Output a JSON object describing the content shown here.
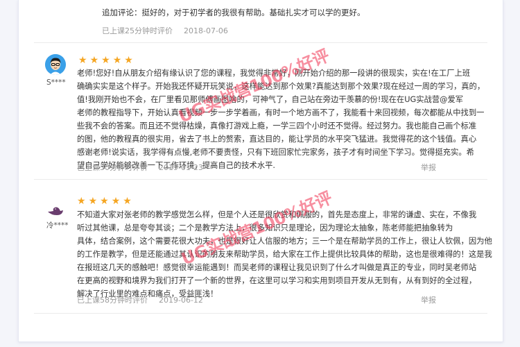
{
  "previous_review": {
    "followup_text": "追加评论：挺好的，对于初学者的我很有帮助。基础扎实才可以学的更好。",
    "meta_time": "已上课25分钟时评价",
    "date": "2018-07-06"
  },
  "reviews": [
    {
      "username": "S****",
      "stars": 5,
      "lines": [
        "老师!您好!自从朋友介绍有缘认识了您的课程，我觉得非常好，刚开始介绍的那一段讲的很现实，实在!在工厂上班",
        "确确实实是这个样子。开始我还怀疑开玩笑说，这样能达到那个效果?真能达到那个效果?现在经过一周的学习，真的，",
        "值!我刚开始也不会，在厂里看见那师傅画图啥的，可神气了，自己站在旁边干羡慕的份!现在在UG实战营@爱军",
        "老师的教程指导下，开始认真看视频一步一步学着画，有时一个地方画不了，我能看十来回视频，每次都能从中找到一",
        "些我不会的答案。而且还不觉得枯燥，真像打游戏上瘾，一学三四个小时还不觉得。经过努力。我也能自己画个标准",
        "的图，他的教程真的很实用，省去了书上的赘索，直达目的，能让学员的水平突飞猛进。我觉得花的这个钱值。真心",
        "感谢老师!说实话，我学得有点慢,老师不要责怪，只有下班回家忙完家务，孩子才有时间坐下学习。觉得挺充实。希",
        "望自己学好能够改善一下工作环境，提高自己的技术水平."
      ],
      "meta_time": "已上课30分钟时评价",
      "date": "2019-01-23",
      "report": "举报"
    },
    {
      "username": "冷****",
      "stars": 5,
      "lines": [
        "不知道大家对张老师的教学感觉怎么样，但是个人还是很欣赏和佩服的，首先是态度上，非常的谦虚、实在，不像我",
        "听过其他课，总是夸夸其谈；二个是教学方法上，很多知识只是理论，因为理论太抽象，陈老师能把抽象转为",
        "具体，结合案例，这个需要花很大功夫，也是很好让人信服的地方；三一个是在帮助学员的工作上，很让人钦佩，因为他",
        "的工作是教学，但是还能通过其认识的朋友来帮助学员，给大家在工作上提供比较具体的帮助，这也是很难得的！这是我",
        "在报班这几天的感触吧！感觉很幸运能遇到！而吴老师的课程让我见识到了什么才叫做是真正的专业，同时吴老师站",
        "在更高的视野和境界为我们打开了一个新的世界，在这里可以学习和实用到项目开发从无到有，从有到好的全过程，",
        "解决了行业里的难点和痛点，受益匪浅！"
      ],
      "meta_time": "已上课58分钟时评价",
      "date": "2019-06-12",
      "report": "举报"
    }
  ],
  "watermark_text": "UG实战营100%好评",
  "colors": {
    "star": "#f5a623",
    "watermark": "#f03250",
    "meta": "#9a9a9a",
    "text": "#333333"
  },
  "icons": {
    "avatar_1": "cartoon-boy-glasses-avatar",
    "avatar_2": "duck-silhouette-avatar",
    "star": "star-icon"
  }
}
